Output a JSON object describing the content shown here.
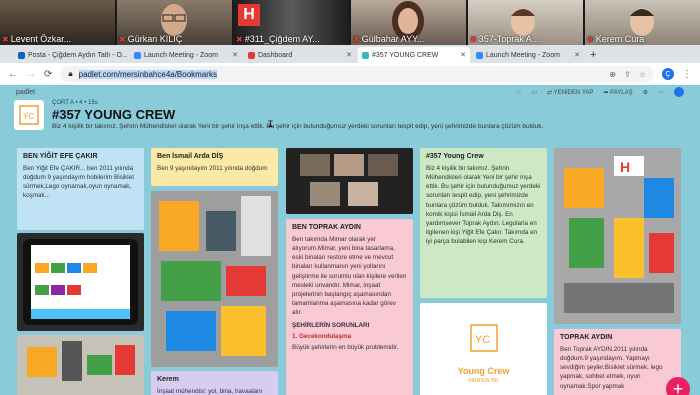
{
  "zoom": {
    "participants": [
      {
        "name": "Levent Özkar..."
      },
      {
        "name": "Gürkan KILIÇ"
      },
      {
        "name": "#311_Çiğdem AY..."
      },
      {
        "name": "Gülbahar AYY..."
      },
      {
        "name": "357-Toprak A..."
      },
      {
        "name": "Kerem Cura"
      }
    ]
  },
  "browser": {
    "tabs": [
      {
        "label": "Posta - Çiğdem Aydın Tatlı - O...",
        "color": "#0a64c8"
      },
      {
        "label": "Launch Meeting - Zoom",
        "color": "#2d8cff"
      },
      {
        "label": "Dashboard",
        "color": "#e53935"
      },
      {
        "label": "#357 YOUNG CREW",
        "color": "#3fb3c2"
      },
      {
        "label": "Launch Meeting - Zoom",
        "color": "#2d8cff"
      }
    ],
    "new_tab": "+",
    "url_prefix": "",
    "url": "padlet.com/mersinbahce4a/Bookmarks",
    "profile_initial": "Ç"
  },
  "padlet": {
    "brand": "padlet",
    "meta": "ÇORT A  •  4  •  15s",
    "title": "#357 YOUNG CREW",
    "description": "Biz 4 kişilik bir takımız. Şehrin Mühendisleri olarak Yeni bir şehir inşa ettik. Bu şehir için bulunduğumuz yerdeki sorunları tespit edip, yeni şehrimizde bunlara çözüm bulduk.",
    "actions": {
      "remake": "YENİDEN YAP",
      "share": "PAYLAŞ"
    }
  },
  "cards": {
    "c1": {
      "title": "BEN YİĞİT EFE ÇAKIR",
      "body": "Ben Yiğit Efe ÇAKIR... ben 2011 yılında doğdum 9 yaşındayım hobilerim Bisiklet sürmek,Lego oynamak,oyun oynamak, koşmak..."
    },
    "c2": {
      "title": "Ben İsmail Arda DİŞ",
      "body": "Ben 9 yaşındayım 2011 yılında doğdum"
    },
    "c3": {
      "title": "BEN TOPRAK AYDIN",
      "body": "Ben takımda Mimar olarak yer alıyorum.Mimar, yeni bina tasarlama, eski binaları restore etme ve mevcut binaları kullanmanın yeni yollarını geliştirme ile sorumlu olan kişilere verilen mesleki unvandır. Mimar, inşaat projelerinin başlangıç aşamasından tamamlanma aşamasına kadar görev alır.",
      "sub": "ŞEHİRLERİN SORUNLARI",
      "item": "1. Gecekondulaşma",
      "tail": "Büyük şehirlerin en büyük problemidir."
    },
    "c4": {
      "title": "#357 Young Crew",
      "body": "Biz 4 kişilik bir takımız. Şehrin Mühendisleri olarak Yeni bir şehir inşa ettik. Bu şehir için bulunduğumuz yerdeki sorunları tespit edip, yeni şehrimizde bunlara çözüm bulduk. Takımımızın en komik kişisi İsmail Arda Diş. En yardımsever Toprak Aydın. Legolarla en ilgilenen kişi Yiğit Efe Çakır. Takımda en iyi parça bulabilen kişi Kerem Cura."
    },
    "c5": {
      "title": "TOPRAK AYDIN",
      "body": "Ben Toprak AYDIN.2011 yılında doğdum.9 yaşındayım. Yapmayı sevdiğim şeyler.Bisiklet sürmek, lego yapmak, sohbet etmek, oyun oynamak.Spor yapmak"
    },
    "c6": {
      "title": "Kerem",
      "body": "İnşaat mühendisi: yol, bina, havaalanı"
    },
    "logo": {
      "name": "Young Crew",
      "sub": "MERSİN BK",
      "mark": "YC"
    }
  },
  "colors": {
    "teal_bg": "#89cbd9",
    "blue_card": "#bfe3f5",
    "yellow_card": "#fce9a7",
    "pink_card": "#f9c9d4",
    "green_card": "#cde8c4",
    "lilac_card": "#d8cdf0"
  }
}
